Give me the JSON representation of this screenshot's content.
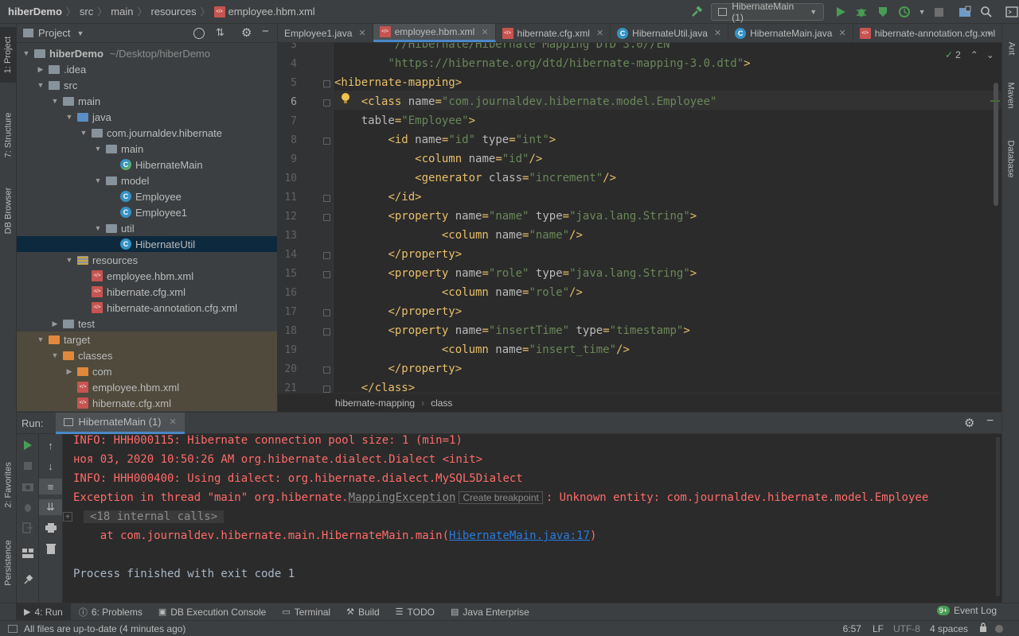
{
  "topbar": {
    "breadcrumb": [
      "hiberDemo",
      "src",
      "main",
      "resources",
      "employee.hbm.xml"
    ],
    "run_config": "HibernateMain (1)"
  },
  "left_strip": {
    "tabs": [
      "1: Project",
      "7: Structure",
      "DB Browser",
      "2: Favorites",
      "Persistence"
    ]
  },
  "right_strip": {
    "tabs": [
      "Ant",
      "Maven",
      "Database"
    ]
  },
  "project": {
    "title": "Project",
    "tree": [
      {
        "label": "hiberDemo",
        "suffix": "~/Desktop/hiberDemo",
        "type": "module",
        "depth": 0,
        "expanded": true
      },
      {
        "label": ".idea",
        "type": "folder",
        "depth": 1,
        "expanded": false
      },
      {
        "label": "src",
        "type": "folder",
        "depth": 1,
        "expanded": true
      },
      {
        "label": "main",
        "type": "folder",
        "depth": 2,
        "expanded": true
      },
      {
        "label": "java",
        "type": "source",
        "depth": 3,
        "expanded": true
      },
      {
        "label": "com.journaldev.hibernate",
        "type": "package",
        "depth": 4,
        "expanded": true
      },
      {
        "label": "main",
        "type": "package",
        "depth": 5,
        "expanded": true
      },
      {
        "label": "HibernateMain",
        "type": "main-class",
        "depth": 6
      },
      {
        "label": "model",
        "type": "package",
        "depth": 5,
        "expanded": true
      },
      {
        "label": "Employee",
        "type": "class",
        "depth": 6
      },
      {
        "label": "Employee1",
        "type": "class",
        "depth": 6
      },
      {
        "label": "util",
        "type": "package",
        "depth": 5,
        "expanded": true
      },
      {
        "label": "HibernateUtil",
        "type": "class",
        "depth": 6,
        "selected": true
      },
      {
        "label": "resources",
        "type": "resources",
        "depth": 3,
        "expanded": true
      },
      {
        "label": "employee.hbm.xml",
        "type": "xml",
        "depth": 4
      },
      {
        "label": "hibernate.cfg.xml",
        "type": "xml",
        "depth": 4
      },
      {
        "label": "hibernate-annotation.cfg.xml",
        "type": "xml",
        "depth": 4
      },
      {
        "label": "test",
        "type": "folder",
        "depth": 2,
        "expanded": false
      },
      {
        "label": "target",
        "type": "excluded",
        "depth": 1,
        "expanded": true
      },
      {
        "label": "classes",
        "type": "excluded",
        "depth": 2,
        "expanded": true
      },
      {
        "label": "com",
        "type": "excluded",
        "depth": 3,
        "expanded": false
      },
      {
        "label": "employee.hbm.xml",
        "type": "xml",
        "depth": 3
      },
      {
        "label": "hibernate.cfg.xml",
        "type": "xml",
        "depth": 3
      }
    ]
  },
  "tabs": [
    {
      "label": "Employee1.java",
      "icon": "class",
      "active": false
    },
    {
      "label": "employee.hbm.xml",
      "icon": "xml",
      "active": true
    },
    {
      "label": "hibernate.cfg.xml",
      "icon": "xml",
      "active": false
    },
    {
      "label": "HibernateUtil.java",
      "icon": "class",
      "active": false
    },
    {
      "label": "HibernateMain.java",
      "icon": "main-class",
      "active": false
    },
    {
      "label": "hibernate-annotation.cfg.xml",
      "icon": "xml",
      "active": false
    }
  ],
  "editor": {
    "inspection_count": "2",
    "lines": [
      {
        "n": "3",
        "html": "<span class='str'>        \"//Hibernate/Hibernate Mapping DTD 3.0//EN\"</span>"
      },
      {
        "n": "4",
        "html": "<span class='str'>        \"https://hibernate.org/dtd/hibernate-mapping-3.0.dtd\"</span><span class='tag'>&gt;</span>"
      },
      {
        "n": "5",
        "html": "<span class='tag'>&lt;hibernate-mapping&gt;</span>"
      },
      {
        "n": "6",
        "html": "    <span class='tag'>&lt;class </span><span class='attr'>name</span><span class='tag'>=</span><span class='str'>\"com.journaldev.hibernate.model.Employee\"</span>"
      },
      {
        "n": "7",
        "html": "    <span class='attr'>table</span><span class='tag'>=</span><span class='str'>\"Employee\"</span><span class='tag'>&gt;</span>"
      },
      {
        "n": "8",
        "html": "        <span class='tag'>&lt;id </span><span class='attr'>name</span><span class='tag'>=</span><span class='str'>\"id\"</span> <span class='attr'>type</span><span class='tag'>=</span><span class='str'>\"int\"</span><span class='tag'>&gt;</span>"
      },
      {
        "n": "9",
        "html": "            <span class='tag'>&lt;column </span><span class='attr'>name</span><span class='tag'>=</span><span class='str'>\"id\"</span><span class='tag'>/&gt;</span>"
      },
      {
        "n": "10",
        "html": "            <span class='tag'>&lt;generator </span><span class='attr'>class</span><span class='tag'>=</span><span class='str'>\"increment\"</span><span class='tag'>/&gt;</span>"
      },
      {
        "n": "11",
        "html": "        <span class='tag'>&lt;/id&gt;</span>"
      },
      {
        "n": "12",
        "html": "        <span class='tag'>&lt;property </span><span class='attr'>name</span><span class='tag'>=</span><span class='str'>\"name\"</span> <span class='attr'>type</span><span class='tag'>=</span><span class='str'>\"java.lang.String\"</span><span class='tag'>&gt;</span>"
      },
      {
        "n": "13",
        "html": "                <span class='tag'>&lt;column </span><span class='attr'>name</span><span class='tag'>=</span><span class='str'>\"name\"</span><span class='tag'>/&gt;</span>"
      },
      {
        "n": "14",
        "html": "        <span class='tag'>&lt;/property&gt;</span>"
      },
      {
        "n": "15",
        "html": "        <span class='tag'>&lt;property </span><span class='attr'>name</span><span class='tag'>=</span><span class='str'>\"role\"</span> <span class='attr'>type</span><span class='tag'>=</span><span class='str'>\"java.lang.String\"</span><span class='tag'>&gt;</span>"
      },
      {
        "n": "16",
        "html": "                <span class='tag'>&lt;column </span><span class='attr'>name</span><span class='tag'>=</span><span class='str'>\"role\"</span><span class='tag'>/&gt;</span>"
      },
      {
        "n": "17",
        "html": "        <span class='tag'>&lt;/property&gt;</span>"
      },
      {
        "n": "18",
        "html": "        <span class='tag'>&lt;property </span><span class='attr'>name</span><span class='tag'>=</span><span class='str'>\"insertTime\"</span> <span class='attr'>type</span><span class='tag'>=</span><span class='str'>\"timestamp\"</span><span class='tag'>&gt;</span>"
      },
      {
        "n": "19",
        "html": "                <span class='tag'>&lt;column </span><span class='attr'>name</span><span class='tag'>=</span><span class='str'>\"insert_time\"</span><span class='tag'>/&gt;</span>"
      },
      {
        "n": "20",
        "html": "        <span class='tag'>&lt;/property&gt;</span>"
      },
      {
        "n": "21",
        "html": "    <span class='tag'>&lt;/class&gt;</span>"
      }
    ],
    "breadcrumb": [
      "hibernate-mapping",
      "class"
    ]
  },
  "run": {
    "label": "Run:",
    "tab": "HibernateMain (1)",
    "console": [
      {
        "text": "INFO: HHH000115: Hibernate connection pool size: 1 (min=1)",
        "style": "red"
      },
      {
        "text": "ноя 03, 2020 10:50:26 AM org.hibernate.dialect.Dialect <init>",
        "style": "red"
      },
      {
        "text": "INFO: HHH000400: Using dialect: org.hibernate.dialect.MySQL5Dialect",
        "style": "red"
      },
      {
        "text": "",
        "style": "exception"
      },
      {
        "text": "<18 internal calls>",
        "style": "folded"
      },
      {
        "text": "",
        "style": "at"
      },
      {
        "text": "",
        "style": "blank"
      },
      {
        "text": "Process finished with exit code 1",
        "style": "normal"
      }
    ],
    "exception": {
      "prefix": "Exception in thread \"main\" org.hibernate.",
      "class_link": "MappingException",
      "breakpoint_hint": "Create breakpoint",
      "suffix": ": Unknown entity: com.journaldev.hibernate.model.Employee"
    },
    "at_line": {
      "prefix": "    at com.journaldev.hibernate.main.HibernateMain.main(",
      "link": "HibernateMain.java:17",
      "suffix": ")"
    }
  },
  "bottom_tabs": [
    {
      "label": "4: Run",
      "icon": "run-icon"
    },
    {
      "label": "6: Problems",
      "icon": "problems-icon"
    },
    {
      "label": "DB Execution Console",
      "icon": "db-console-icon"
    },
    {
      "label": "Terminal",
      "icon": "terminal-icon"
    },
    {
      "label": "Build",
      "icon": "build-icon"
    },
    {
      "label": "TODO",
      "icon": "todo-icon"
    },
    {
      "label": "Java Enterprise",
      "icon": "java-enterprise-icon"
    }
  ],
  "event_log": "Event Log",
  "event_log_badge": "9+",
  "status": {
    "message": "All files are up-to-date (4 minutes ago)",
    "position": "6:57",
    "line_sep": "LF",
    "encoding": "UTF-8",
    "indent": "4 spaces"
  },
  "colors": {
    "accent": "#4a88c7",
    "run_green": "#499c54",
    "error_red": "#ff6b68",
    "folder_blue": "#87939a",
    "excluded_orange": "#e1883c"
  }
}
